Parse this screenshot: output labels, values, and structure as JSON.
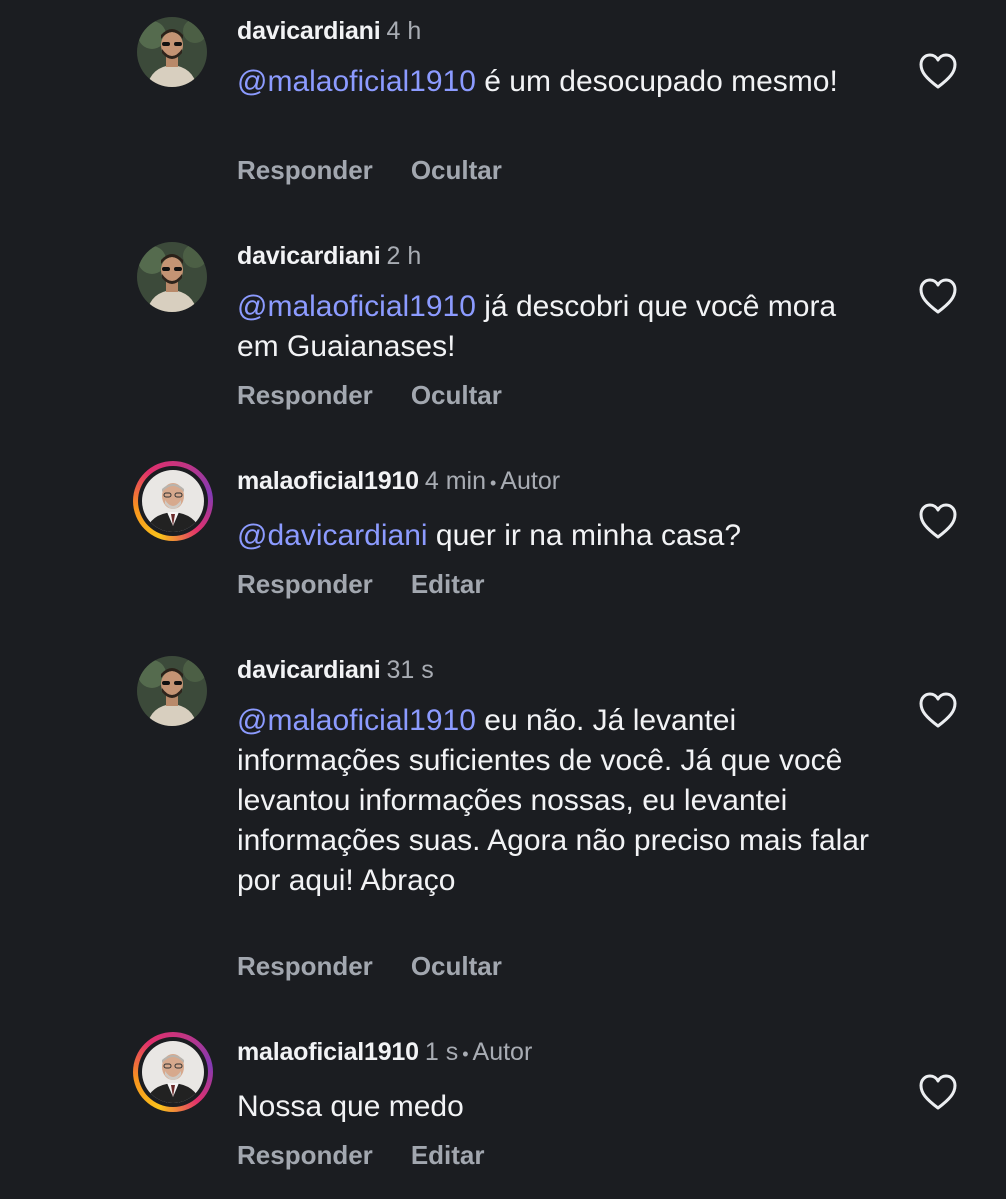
{
  "colors": {
    "background": "#1b1d21",
    "mention": "#8c9bff",
    "secondary_text": "#a8acb3"
  },
  "comments": [
    {
      "username": "davicardiani",
      "time": "4 h",
      "mention": "@malaoficial1910",
      "text": " é um desocupado mesmo!",
      "reply_label": "Responder",
      "second_action": "Ocultar",
      "like_icon": "heart-outline-icon"
    },
    {
      "username": "davicardiani",
      "time": "2 h",
      "mention": "@malaoficial1910",
      "text": " já descobri que você mora em Guaianases!",
      "reply_label": "Responder",
      "second_action": "Ocultar",
      "like_icon": "heart-outline-icon"
    },
    {
      "username": "malaoficial1910",
      "time": "4 min",
      "separator": "•",
      "role": "Autor",
      "mention": "@davicardiani",
      "text": " quer ir na minha casa?",
      "reply_label": "Responder",
      "second_action": "Editar",
      "like_icon": "heart-outline-icon"
    },
    {
      "username": "davicardiani",
      "time": "31 s",
      "mention": "@malaoficial1910",
      "text": " eu não. Já levantei informações suficientes de você. Já que você levantou informações nossas, eu levantei informações suas. Agora não preciso mais falar por aqui! Abraço",
      "reply_label": "Responder",
      "second_action": "Ocultar",
      "like_icon": "heart-outline-icon"
    },
    {
      "username": "malaoficial1910",
      "time": "1 s",
      "separator": "•",
      "role": "Autor",
      "mention": "",
      "text": "Nossa que medo",
      "reply_label": "Responder",
      "second_action": "Editar",
      "like_icon": "heart-outline-icon"
    }
  ]
}
